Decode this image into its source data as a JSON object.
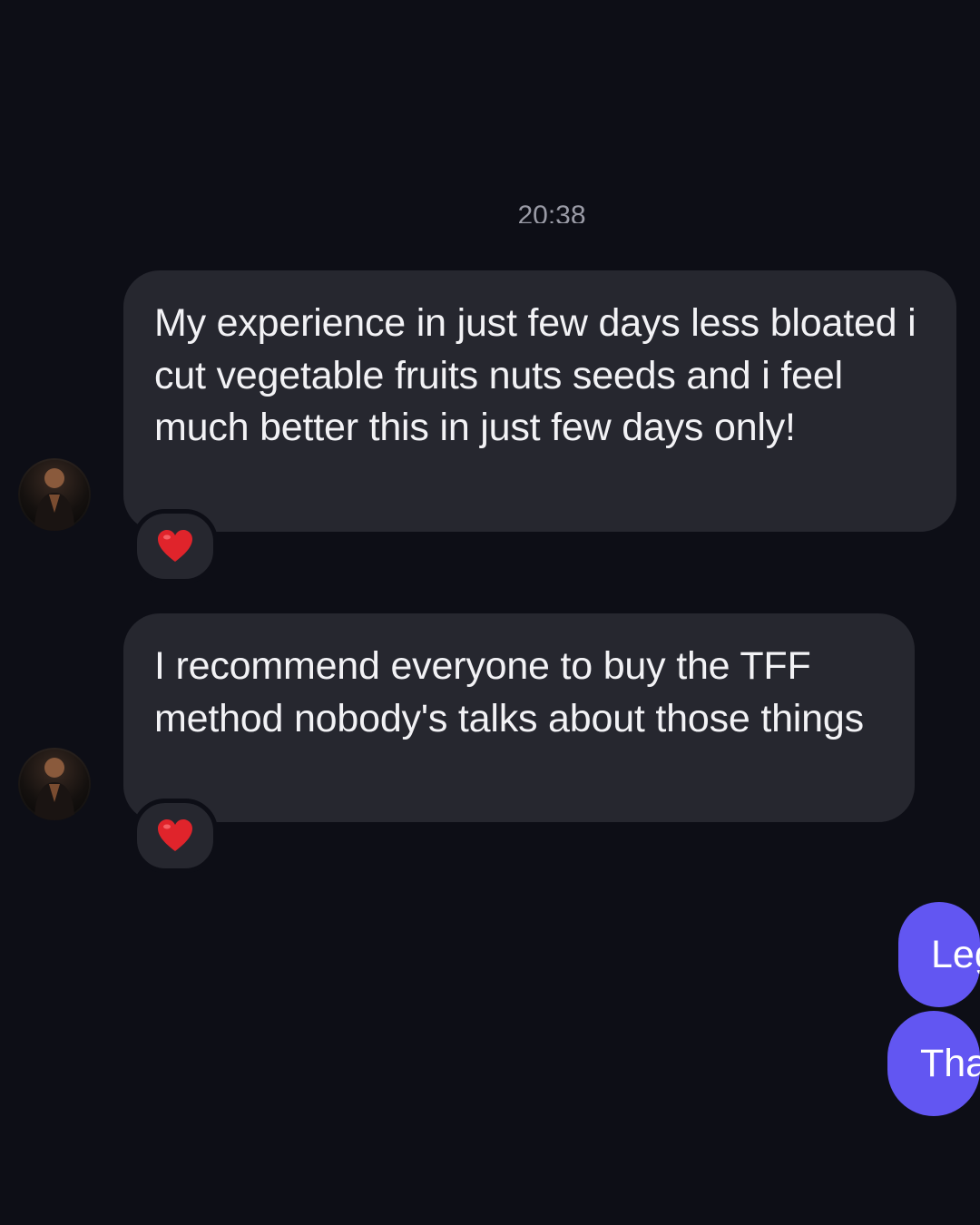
{
  "header": {
    "timestamp": "20:38"
  },
  "messages": [
    {
      "direction": "incoming",
      "text": "My experience in just few days less bloated i cut vegetable fruits nuts seeds and i feel much better this in just few days only!",
      "reaction": "heart"
    },
    {
      "direction": "incoming",
      "text": "I recommend everyone to buy the TFF method nobody's talks about those things",
      "reaction": "heart"
    },
    {
      "direction": "outgoing",
      "text": "Leg"
    },
    {
      "direction": "outgoing",
      "text": "Tha"
    }
  ],
  "colors": {
    "background": "#0d0e16",
    "incoming_bubble": "#26272f",
    "outgoing_bubble": "#6256f2",
    "reaction_heart": "#e0242b"
  }
}
